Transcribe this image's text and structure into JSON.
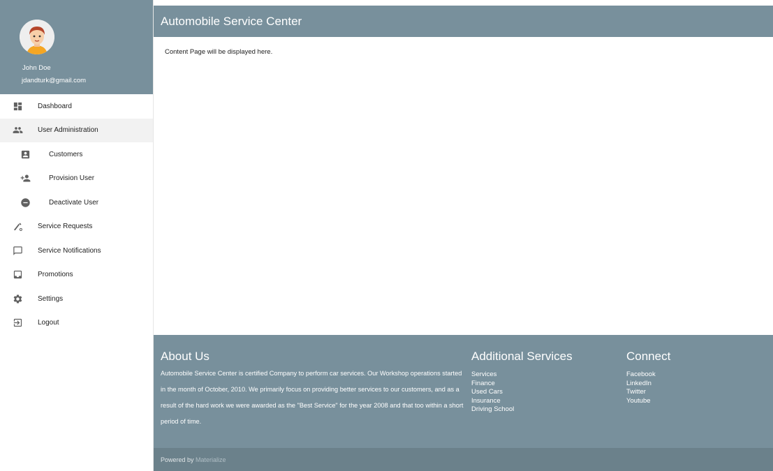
{
  "user": {
    "name": "John Doe",
    "email": "jdandturk@gmail.com"
  },
  "sidebar": {
    "items": [
      {
        "label": "Dashboard",
        "icon": "dashboard-icon"
      },
      {
        "label": "User Administration",
        "icon": "users-icon"
      },
      {
        "label": "Customers",
        "icon": "account-box-icon"
      },
      {
        "label": "Provision User",
        "icon": "person-add-icon"
      },
      {
        "label": "Deactivate User",
        "icon": "remove-circle-icon"
      },
      {
        "label": "Service Requests",
        "icon": "build-icon"
      },
      {
        "label": "Service Notifications",
        "icon": "chat-icon"
      },
      {
        "label": "Promotions",
        "icon": "inbox-icon"
      },
      {
        "label": "Settings",
        "icon": "gear-icon"
      },
      {
        "label": "Logout",
        "icon": "logout-icon"
      }
    ]
  },
  "header": {
    "title": "Automobile Service Center"
  },
  "main": {
    "content_text": "Content Page will be displayed here."
  },
  "footer": {
    "about": {
      "heading": "About Us",
      "text": "Automobile Service Center is certified Company to perform car services. Our Workshop operations started in the month of October, 2010. We primarily focus on providing better services to our customers, and as a result of the hard work we were awarded as the \"Best Service\" for the year 2008 and that too within a short period of time."
    },
    "services": {
      "heading": "Additional Services",
      "links": [
        "Services",
        "Finance",
        "Used Cars",
        "Insurance",
        "Driving School"
      ]
    },
    "connect": {
      "heading": "Connect",
      "links": [
        "Facebook",
        "LinkedIn",
        "Twitter",
        "Youtube"
      ]
    },
    "powered_prefix": "Powered by ",
    "powered_brand": "Materialize"
  },
  "colors": {
    "primary": "#78909c",
    "footer_bottom": "#6b818b",
    "active_row": "#f2f2f2"
  }
}
